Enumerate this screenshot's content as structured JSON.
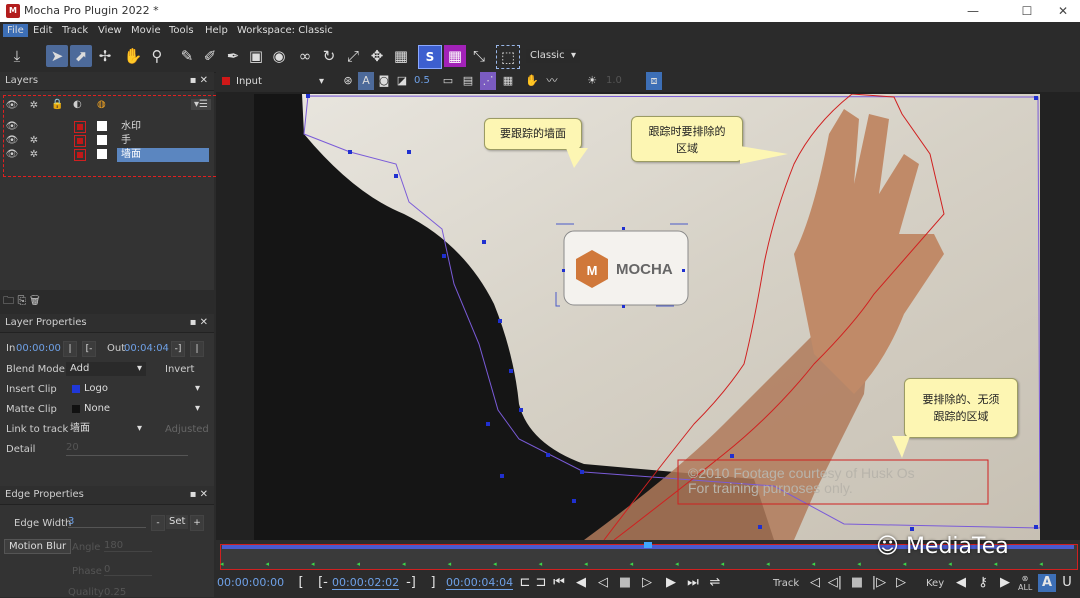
{
  "window": {
    "title": "Mocha Pro Plugin 2022 *",
    "app_icon": "M",
    "minimize": "—",
    "maximize": "☐",
    "close": "✕"
  },
  "menu": [
    "File",
    "Edit",
    "Track",
    "View",
    "Movie",
    "Tools",
    "Help",
    "Workspace: Classic"
  ],
  "toolbar": {
    "workspace_select": "Classic"
  },
  "layers_panel": {
    "title": "Layers",
    "layers": [
      {
        "name": "水印",
        "gear": false,
        "selected": false
      },
      {
        "name": "手",
        "gear": true,
        "selected": false
      },
      {
        "name": "墙面",
        "gear": true,
        "selected": true
      }
    ]
  },
  "viewer_bar": {
    "view_select": "Input",
    "opacity_value": "0.5",
    "brightness_value": "1.0"
  },
  "layer_properties": {
    "title": "Layer Properties",
    "in_label": "In",
    "in_value": "00:00:00",
    "out_label": "Out",
    "out_value": "00:04:04",
    "blend_mode_label": "Blend Mode",
    "blend_mode_value": "Add",
    "invert_label": "Invert",
    "insert_clip_label": "Insert Clip",
    "insert_clip_value": "Logo",
    "matte_clip_label": "Matte Clip",
    "matte_clip_value": "None",
    "link_to_track_label": "Link to track",
    "link_to_track_value": "墙面",
    "adjusted_label": "Adjusted",
    "detail_label": "Detail",
    "detail_value": "20"
  },
  "edge_properties": {
    "title": "Edge Properties",
    "edge_width_label": "Edge Width",
    "edge_width_value": "3",
    "set_label": "Set",
    "motion_blur_label": "Motion Blur",
    "angle_label": "Angle",
    "angle_value": "180",
    "phase_label": "Phase",
    "phase_value": "0",
    "quality_label": "Quality",
    "quality_value": "0.25"
  },
  "viewer": {
    "callouts": {
      "wall": "要跟踪的墙面",
      "exclude_track": [
        "跟踪时要排除的",
        "区域"
      ],
      "exclude_no": [
        "要排除的、无须",
        "跟踪的区域"
      ]
    },
    "logo_text": "MOCHA",
    "logo_letter": "M",
    "watermark_lines": [
      "©2010 Footage courtesy of Husk Os",
      "For training purposes only."
    ],
    "brand_watermark": "MediaTea"
  },
  "transport": {
    "current_time": "00:00:00:00",
    "in_time": "00:00:02:02",
    "out_time": "00:00:04:04",
    "track_label": "Track",
    "key_label": "Key",
    "all_label": "ALL"
  },
  "colors": {
    "accent": "#3d6fb6",
    "red": "#d02020",
    "callout": "#fdf6b3",
    "time": "#6ea0e6"
  }
}
